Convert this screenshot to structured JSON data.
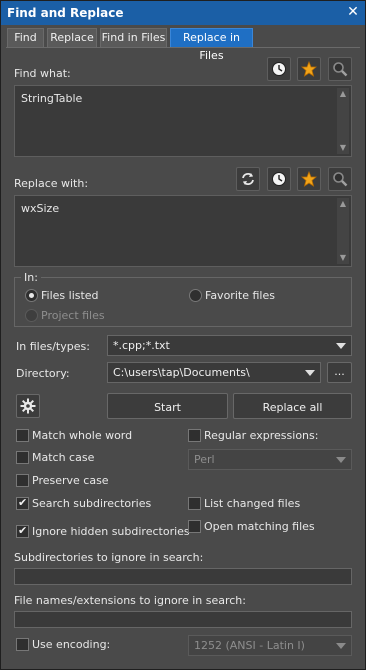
{
  "window": {
    "title": "Find and Replace",
    "close_icon": "close-icon"
  },
  "tabs": [
    {
      "label": "Find",
      "active": false
    },
    {
      "label": "Replace",
      "active": false
    },
    {
      "label": "Find in Files",
      "active": false
    },
    {
      "label": "Replace in Files",
      "active": true
    }
  ],
  "find_what": {
    "label": "Find what:",
    "value": "StringTable",
    "buttons": [
      "history-clock-icon",
      "favorite-star-icon",
      "search-magnifier-icon"
    ]
  },
  "replace_with": {
    "label": "Replace with:",
    "value": "wxSize",
    "buttons": [
      "swap-refresh-icon",
      "history-clock-icon",
      "favorite-star-icon",
      "search-magnifier-icon"
    ]
  },
  "in_group": {
    "label": "In:",
    "options": [
      {
        "label": "Files listed",
        "selected": true,
        "enabled": true
      },
      {
        "label": "Favorite files",
        "selected": false,
        "enabled": true
      },
      {
        "label": "Project files",
        "selected": false,
        "enabled": false
      }
    ]
  },
  "file_types": {
    "label": "In files/types:",
    "value": "*.cpp;*.txt"
  },
  "directory": {
    "label": "Directory:",
    "value": "C:\\users\\tap\\Documents\\",
    "browse_label": "..."
  },
  "actions": {
    "settings_icon": "gear-icon",
    "start": "Start",
    "replace_all": "Replace all"
  },
  "options": {
    "match_whole_word": {
      "label": "Match whole word",
      "checked": false
    },
    "regular_expressions": {
      "label": "Regular expressions:",
      "checked": false
    },
    "regex_engine": "Perl",
    "match_case": {
      "label": "Match case",
      "checked": false
    },
    "preserve_case": {
      "label": "Preserve case",
      "checked": false
    },
    "search_subdirectories": {
      "label": "Search subdirectories",
      "checked": true
    },
    "list_changed_files": {
      "label": "List changed files",
      "checked": false
    },
    "ignore_hidden_subdirectories": {
      "label": "Ignore hidden subdirectories",
      "checked": true
    },
    "open_matching_files": {
      "label": "Open matching files",
      "checked": false
    }
  },
  "subdirs_ignore": {
    "label": "Subdirectories to ignore in search:",
    "value": ""
  },
  "names_ignore": {
    "label": "File names/extensions to ignore in search:",
    "value": ""
  },
  "encoding": {
    "label": "Use encoding:",
    "checked": false,
    "value": "1252  (ANSI - Latin I)"
  },
  "colors": {
    "title_bar": "#1b5fa6",
    "active_tab": "#1f6fc4",
    "background": "#4a4a4a"
  }
}
